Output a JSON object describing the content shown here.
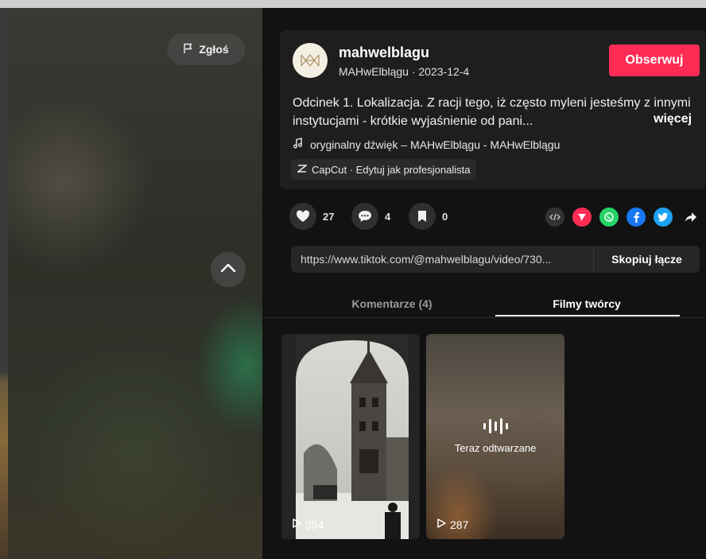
{
  "video": {
    "report_label": "Zgłoś"
  },
  "author": {
    "username": "mahwelblagu",
    "display_name": "MAHwElblągu",
    "date": "2023-12-4",
    "follow_label": "Obserwuj"
  },
  "post": {
    "description": "Odcinek 1. Lokalizacja. Z racji tego, iż często myleni jesteśmy z innymi instytucjami - krótkie wyjaśnienie od pani...",
    "more_label": "więcej",
    "sound": "oryginalny dźwięk – MAHwElblągu - MAHwElblągu",
    "capcut": "CapCut · Edytuj jak profesjonalista"
  },
  "actions": {
    "likes": "27",
    "comments": "4",
    "saves": "0"
  },
  "share": {
    "link": "https://www.tiktok.com/@mahwelblagu/video/730...",
    "copy_label": "Skopiuj łącze"
  },
  "tabs": {
    "comments_label": "Komentarze (4)",
    "videos_label": "Filmy twórcy"
  },
  "videos": [
    {
      "views": "354"
    },
    {
      "views": "287",
      "status": "Teraz odtwarzane"
    }
  ],
  "colors": {
    "follow": "#fe2c55",
    "background": "#121212",
    "card": "#1e1e1e"
  }
}
